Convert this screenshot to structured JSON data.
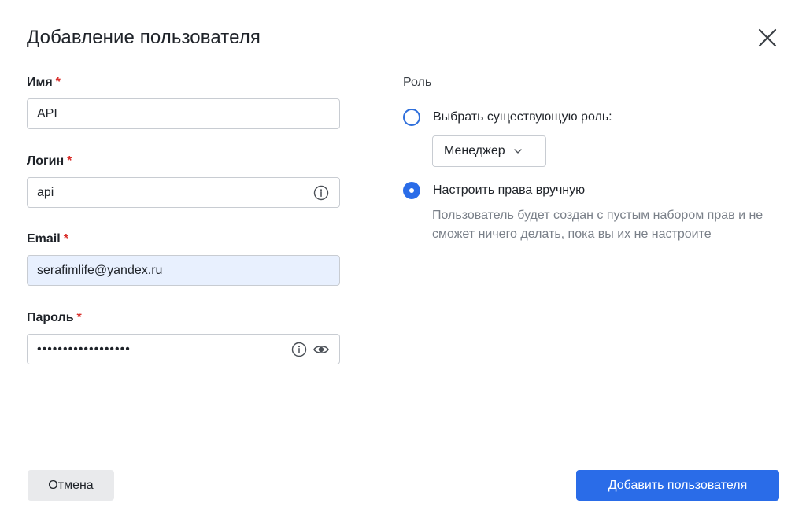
{
  "dialog": {
    "title": "Добавление пользователя"
  },
  "form": {
    "required_mark": "*",
    "name": {
      "label": "Имя",
      "value": "API"
    },
    "login": {
      "label": "Логин",
      "value": "api"
    },
    "email": {
      "label": "Email",
      "value": "serafimlife@yandex.ru"
    },
    "password": {
      "label": "Пароль",
      "value": "••••••••••••••••••"
    }
  },
  "role": {
    "title": "Роль",
    "option_existing": {
      "label": "Выбрать существующую роль:",
      "checked": false
    },
    "selected_role": "Менеджер",
    "option_manual": {
      "label": "Настроить права вручную",
      "checked": true
    },
    "manual_hint": "Пользователь будет создан с пустым набором прав и не сможет ничего делать, пока вы их не настроите"
  },
  "actions": {
    "cancel": "Отмена",
    "submit": "Добавить пользователя"
  },
  "colors": {
    "primary": "#2a6ce8",
    "required": "#d9302c",
    "autofill_bg": "#e8f0fe"
  },
  "icons": [
    "close-icon",
    "info-icon",
    "eye-icon",
    "chevron-down-icon"
  ]
}
